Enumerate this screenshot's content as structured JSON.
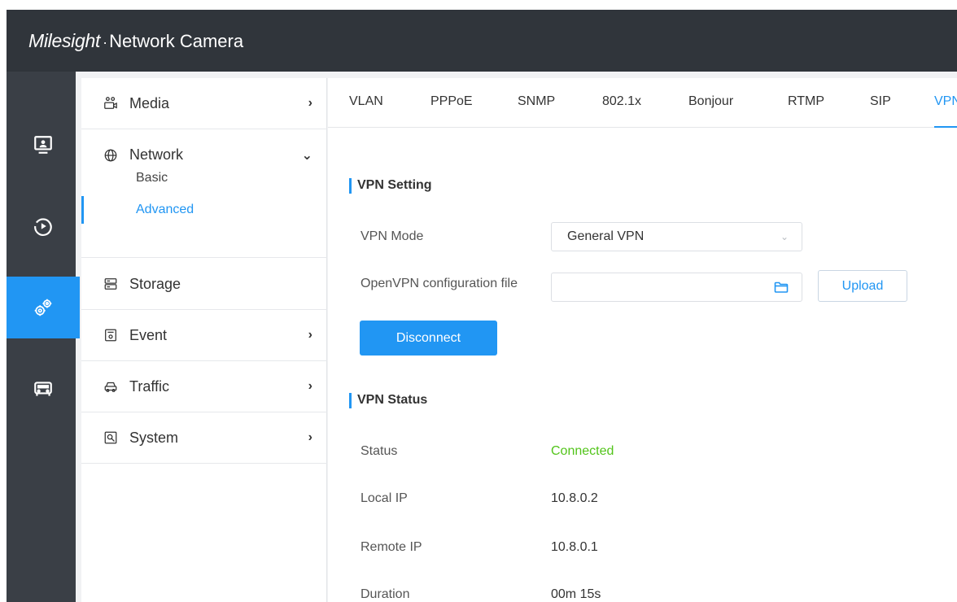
{
  "header": {
    "brand": "Milesight",
    "separator": "·",
    "product": "Network Camera"
  },
  "rail": {
    "items": [
      {
        "name": "live-view",
        "icon": "monitor-icon"
      },
      {
        "name": "playback",
        "icon": "play-circle-icon"
      },
      {
        "name": "settings",
        "icon": "gears-icon",
        "active": true
      },
      {
        "name": "traffic",
        "icon": "car-icon"
      }
    ]
  },
  "submenu": {
    "media": {
      "label": "Media",
      "arrow": "›"
    },
    "network": {
      "label": "Network",
      "arrow": "⌄",
      "children": {
        "basic": "Basic",
        "advanced": "Advanced"
      }
    },
    "storage": {
      "label": "Storage"
    },
    "event": {
      "label": "Event",
      "arrow": "›"
    },
    "traffic": {
      "label": "Traffic",
      "arrow": "›"
    },
    "system": {
      "label": "System",
      "arrow": "›"
    }
  },
  "tabs": [
    "VLAN",
    "PPPoE",
    "SNMP",
    "802.1x",
    "Bonjour",
    "RTMP",
    "SIP",
    "VPN"
  ],
  "active_tab": "VPN",
  "vpn_setting": {
    "title": "VPN Setting",
    "mode_label": "VPN Mode",
    "mode_value": "General VPN",
    "config_label": "OpenVPN configuration file",
    "config_value": "",
    "upload_label": "Upload",
    "disconnect_label": "Disconnect"
  },
  "vpn_status": {
    "title": "VPN Status",
    "status_label": "Status",
    "status_value": "Connected",
    "local_ip_label": "Local IP",
    "local_ip_value": "10.8.0.2",
    "remote_ip_label": "Remote IP",
    "remote_ip_value": "10.8.0.1",
    "duration_label": "Duration",
    "duration_value": "00m 15s"
  },
  "colors": {
    "accent": "#2196f3",
    "header_bg": "#30353b",
    "rail_bg": "#3a3f46",
    "connected": "#52c41a"
  }
}
